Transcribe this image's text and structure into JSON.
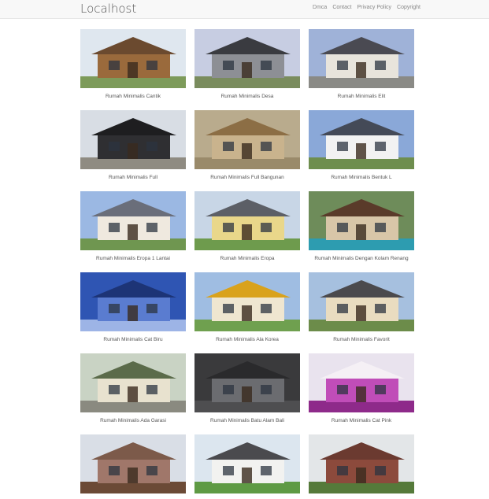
{
  "header": {
    "brand": "Localhost",
    "links": [
      "Dmca",
      "Contact",
      "Privacy Policy",
      "Copyright"
    ]
  },
  "gallery": [
    {
      "caption": "Rumah Minimalis Cantik",
      "sky": "#dfe7ef",
      "wall": "#9a6a3c",
      "roof": "#6b4a2f",
      "ground": "#7d9b5a"
    },
    {
      "caption": "Rumah Minimalis Desa",
      "sky": "#c7cde2",
      "wall": "#8d8f95",
      "roof": "#3a3b40",
      "ground": "#7a8c5e"
    },
    {
      "caption": "Rumah Minimalis Elit",
      "sky": "#9fb2d8",
      "wall": "#e8e4dc",
      "roof": "#4a4a52",
      "ground": "#8a8a86"
    },
    {
      "caption": "Rumah Minimalis Full",
      "sky": "#d8dde4",
      "wall": "#2f2f32",
      "roof": "#1e1e20",
      "ground": "#8f8b82"
    },
    {
      "caption": "Rumah Minimalis Full Bangunan",
      "sky": "#b9ab8d",
      "wall": "#c9b38d",
      "roof": "#8c6e45",
      "ground": "#9a8a6a"
    },
    {
      "caption": "Rumah Minimalis Bentuk L",
      "sky": "#8aa8d8",
      "wall": "#f2f2f2",
      "roof": "#444a57",
      "ground": "#6e8e4e"
    },
    {
      "caption": "Rumah Minimalis Eropa 1 Lantai",
      "sky": "#9bb8e3",
      "wall": "#efe9df",
      "roof": "#6a6e7a",
      "ground": "#6f9650"
    },
    {
      "caption": "Rumah Minimalis Eropa",
      "sky": "#c8d6e6",
      "wall": "#e9d78a",
      "roof": "#5c5f66",
      "ground": "#6e9b4d"
    },
    {
      "caption": "Rumah Minimalis Dengan Kolam Renang",
      "sky": "#6e8c5a",
      "wall": "#d8c6a8",
      "roof": "#5a3b2a",
      "ground": "#2d9cb0"
    },
    {
      "caption": "Rumah Minimalis Cat Biru",
      "sky": "#2f55b3",
      "wall": "#5a7cd0",
      "roof": "#1d3476",
      "ground": "#9db4e6"
    },
    {
      "caption": "Rumah Minimalis Ala Korea",
      "sky": "#9fbde2",
      "wall": "#efe6d0",
      "roof": "#d9a21c",
      "ground": "#6fa04f"
    },
    {
      "caption": "Rumah Minimalis Favorit",
      "sky": "#a6c0df",
      "wall": "#e9dcc0",
      "roof": "#4b4a4d",
      "ground": "#6c8c4a"
    },
    {
      "caption": "Rumah Minimalis Ada Garasi",
      "sky": "#c9d3c4",
      "wall": "#e8e2cf",
      "roof": "#5b6b4a",
      "ground": "#8a8a80"
    },
    {
      "caption": "Rumah Minimalis Batu Alam Bali",
      "sky": "#3a3a3c",
      "wall": "#6b6c70",
      "roof": "#2a2a2c",
      "ground": "#4e4e50"
    },
    {
      "caption": "Rumah Minimalis Cat Pink",
      "sky": "#e9e3ee",
      "wall": "#c04db8",
      "roof": "#f5f0f5",
      "ground": "#8e2a8a"
    },
    {
      "caption": "",
      "sky": "#d9dee6",
      "wall": "#a0776a",
      "roof": "#7c5a4a",
      "ground": "#6b4a36"
    },
    {
      "caption": "",
      "sky": "#dce6ef",
      "wall": "#f2f2f0",
      "roof": "#4a4a4e",
      "ground": "#5e9a44"
    },
    {
      "caption": "",
      "sky": "#e3e6e8",
      "wall": "#8c4a3c",
      "roof": "#6b3a30",
      "ground": "#557a3a"
    }
  ]
}
